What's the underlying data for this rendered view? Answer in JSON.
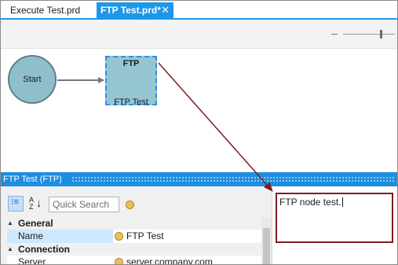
{
  "tabs": [
    {
      "label": "Execute Test.prd",
      "active": false
    },
    {
      "label": "FTP Test.prd*",
      "active": true,
      "close_glyph": "✕"
    }
  ],
  "canvas": {
    "nodes": {
      "start": {
        "label": "Start"
      },
      "ftp": {
        "title": "FTP",
        "label": "FTP Test"
      }
    }
  },
  "properties": {
    "header": "FTP Test (FTP)",
    "search_placeholder": "Quick Search",
    "sections": [
      {
        "label": "General",
        "rows": [
          {
            "name": "Name",
            "value": "FTP Test",
            "selected": true
          }
        ]
      },
      {
        "label": "Connection",
        "rows": [
          {
            "name": "Server",
            "value": "server.company.com"
          }
        ]
      }
    ]
  },
  "description": {
    "text": "FTP node test."
  },
  "colors": {
    "accent": "#1c97ea",
    "callout": "#7f1d20",
    "node_fill": "#96c6d3"
  }
}
